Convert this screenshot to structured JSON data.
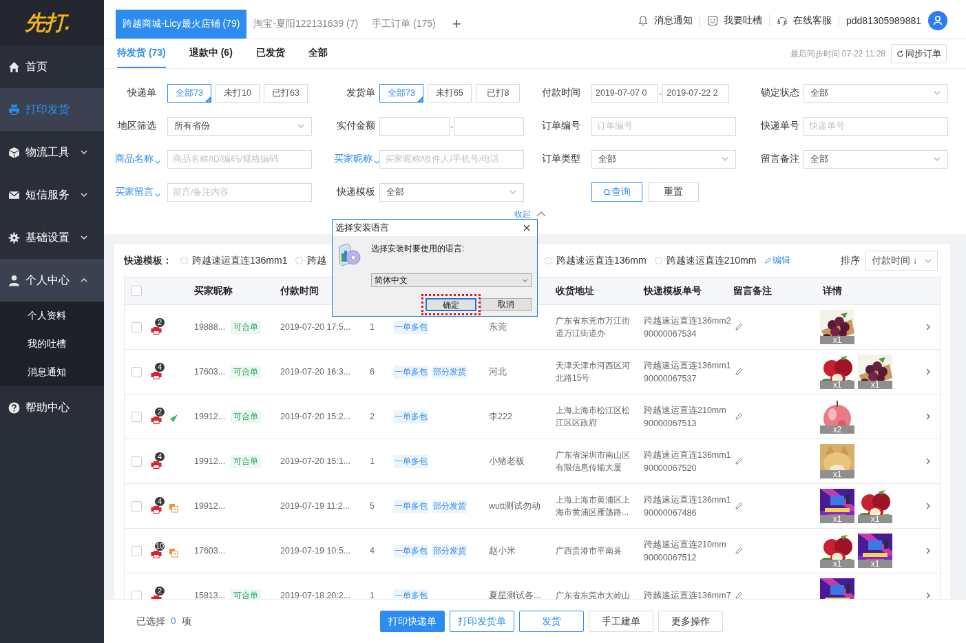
{
  "sidebar": {
    "logo": "先打.",
    "items": [
      {
        "label": "首页",
        "selected": false
      },
      {
        "label": "打印发货",
        "selected": true
      },
      {
        "label": "物流工具",
        "selected": false,
        "expanded": false
      },
      {
        "label": "短信服务",
        "selected": false,
        "expanded": false
      },
      {
        "label": "基础设置",
        "selected": false,
        "expanded": false
      },
      {
        "label": "个人中心",
        "selected": false,
        "expanded": true,
        "children": [
          {
            "label": "个人资料",
            "selected": false
          },
          {
            "label": "我的吐槽",
            "selected": false
          },
          {
            "label": "消息通知",
            "selected": false
          }
        ]
      },
      {
        "label": "帮助中心",
        "selected": false
      }
    ]
  },
  "shop_tabs": [
    {
      "label": "跨越商城-Licy最火店铺 (79)",
      "selected": true
    },
    {
      "label": "淘宝-夏阳122131639 (7)",
      "selected": false
    },
    {
      "label": "手工订单 (175)",
      "selected": false
    }
  ],
  "add_tab": "+",
  "header_links": [
    {
      "label": "消息通知"
    },
    {
      "label": "我要吐槽"
    },
    {
      "label": "在线客服"
    }
  ],
  "user": "pdd81305989881",
  "status_tabs": [
    {
      "label": "待发货 (73)",
      "selected": true
    },
    {
      "label": "退款中 (6)",
      "selected": false
    },
    {
      "label": "已发货",
      "selected": false
    },
    {
      "label": "全部",
      "selected": false
    }
  ],
  "sync": {
    "last_sync": "最后同步时间 07-22 11:28",
    "button": "同步订单"
  },
  "filters": {
    "fields": [
      {
        "kind": "segments",
        "label": "快递单",
        "label_dropdown": false,
        "options": [
          {
            "label": "全部73",
            "selected": true
          },
          {
            "label": "未打10",
            "selected": false
          },
          {
            "label": "已打63",
            "selected": false
          }
        ]
      },
      {
        "kind": "segments",
        "label": "发货单",
        "label_dropdown": false,
        "options": [
          {
            "label": "全部73",
            "selected": true
          },
          {
            "label": "未打65",
            "selected": false
          },
          {
            "label": "已打8",
            "selected": false
          }
        ]
      },
      {
        "kind": "date_range",
        "label": "付款时间",
        "label_dropdown": false,
        "start": "2019-07-07 0",
        "separator": "-",
        "end": "2019-07-22 2"
      },
      {
        "kind": "select",
        "label": "锁定状态",
        "label_dropdown": false,
        "value": "全部"
      },
      {
        "kind": "select",
        "label": "地区筛选",
        "label_dropdown": false,
        "value": "所有省份"
      },
      {
        "kind": "range",
        "label": "实付金额",
        "label_dropdown": false,
        "separator": "-"
      },
      {
        "kind": "input",
        "label": "订单编号",
        "label_dropdown": false,
        "placeholder": "订单编号"
      },
      {
        "kind": "input",
        "label": "快递单号",
        "label_dropdown": false,
        "placeholder": "快递单号"
      },
      {
        "kind": "input",
        "label": "商品名称",
        "label_dropdown": true,
        "placeholder": "商品名称/ID/编码/规格编码"
      },
      {
        "kind": "input",
        "label": "买家昵称",
        "label_dropdown": true,
        "placeholder": "买家昵称/收件人/手机号/电话"
      },
      {
        "kind": "select",
        "label": "订单类型",
        "label_dropdown": false,
        "value": "全部"
      },
      {
        "kind": "select",
        "label": "留言备注",
        "label_dropdown": false,
        "value": "全部"
      },
      {
        "kind": "input",
        "label": "买家留言",
        "label_dropdown": true,
        "placeholder": "留言/备注内容"
      },
      {
        "kind": "select",
        "label": "快递模板",
        "label_dropdown": false,
        "value": "全部"
      },
      {
        "kind": "buttons",
        "search": "查询",
        "reset": "重置"
      }
    ],
    "collapse": "收起"
  },
  "toolbar": {
    "label": "快递模板：",
    "radios": [
      {
        "label": "跨越速运直连136mm1",
        "selected": false
      },
      {
        "label": "跨越",
        "selected": false
      },
      {
        "label": "跨越速运直连136mm",
        "selected": false
      },
      {
        "label": "跨越速运直连210mm",
        "selected": false
      }
    ],
    "edit": "编辑",
    "sort_label": "排序",
    "sort_value": "付款时间 ↓"
  },
  "table": {
    "select_all": {
      "checked": false
    },
    "columns": {
      "buyer": "买家昵称",
      "pay_time": "付款时间",
      "address": "收货地址",
      "template": "快递模板单号",
      "remark": "留言备注",
      "details": "详情"
    },
    "rows": [
      {
        "checked": false,
        "print_count": "2",
        "buyer": "19888...",
        "merge_tag": "可合单",
        "pay_time": "2019-07-20 17:5...",
        "count": "1",
        "tags": [
          "一单多包"
        ],
        "receiver": "东莞",
        "address": "广东省东莞市万江街道万江街道办",
        "template": "跨越速运直连136mm2",
        "tracking_no": "90000067534",
        "products": [
          {
            "qty": "x1"
          }
        ]
      },
      {
        "checked": false,
        "print_count": "4",
        "buyer": "17603...",
        "merge_tag": "可合单",
        "pay_time": "2019-07-20 16:3...",
        "count": "6",
        "tags": [
          "一单多包",
          "部分发货"
        ],
        "receiver": "河北",
        "address": "天津天津市河西区河北路15号",
        "template": "跨越速运直连136mm1",
        "tracking_no": "90000067537",
        "products": [
          {
            "qty": "x1"
          },
          {
            "qty": "x1"
          }
        ]
      },
      {
        "checked": false,
        "print_count": "2",
        "kind": "send",
        "buyer": "19912...",
        "merge_tag": "可合单",
        "pay_time": "2019-07-20 15:2...",
        "count": "2",
        "tags": [
          "一单多包"
        ],
        "receiver": "李222",
        "address": "上海上海市松江区松江区区政府",
        "template": "跨越速运直连210mm",
        "tracking_no": "90000067513",
        "products": [
          {
            "qty": "x2"
          }
        ]
      },
      {
        "checked": false,
        "print_count": "4",
        "buyer": "19912...",
        "merge_tag": "可合单",
        "pay_time": "2019-07-20 15:1...",
        "count": "1",
        "tags": [
          "一单多包"
        ],
        "receiver": "小猪老板",
        "address": "广东省深圳市南山区有限信息传输大厦",
        "template": "跨越速运直连136mm1",
        "tracking_no": "90000067520",
        "products": [
          {
            "qty": "x1"
          }
        ]
      },
      {
        "checked": false,
        "print_count": "4",
        "kind": "merge",
        "buyer": "19912...",
        "pay_time": "2019-07-19 11:2...",
        "count": "5",
        "tags": [
          "一单多包",
          "部分发货"
        ],
        "receiver": "wutt测试勿动",
        "address": "上海上海市黄浦区上海市黄浦区雁荡路...",
        "template": "跨越速运直连136mm1",
        "tracking_no": "90000067486",
        "products": [
          {
            "qty": "x1"
          },
          {
            "qty": "x1"
          }
        ]
      },
      {
        "checked": false,
        "print_count": "10",
        "kind": "merge",
        "buyer": "17603...",
        "pay_time": "2019-07-19 10:5...",
        "count": "4",
        "tags": [
          "一单多包",
          "部分发货"
        ],
        "receiver": "赵小米",
        "address": "广西贵港市平南县",
        "template": "跨越速运直连210mm",
        "tracking_no": "90000067512",
        "products": [
          {
            "qty": "x1"
          },
          {
            "qty": "x1"
          }
        ]
      },
      {
        "checked": false,
        "print_count": "2",
        "buyer": "15813...",
        "merge_tag": "可合单",
        "pay_time": "2019-07-18 20:2...",
        "count": "1",
        "tags": [
          "一单多包"
        ],
        "receiver": "夏星测试各...",
        "address": "广东省东莞市大岭山",
        "template": "跨越速运直连136mm7",
        "products": [
          {
            "kind": "picture"
          }
        ]
      }
    ]
  },
  "footer": {
    "selected_label": "已选择",
    "selected_count": "0",
    "selected_unit": "项",
    "buttons": [
      {
        "label": "打印快递单",
        "kind": "primary"
      },
      {
        "label": "打印发货单",
        "kind": "outline"
      },
      {
        "label": "发货",
        "kind": "outline"
      },
      {
        "label": "手工建单",
        "kind": "default"
      },
      {
        "label": "更多操作",
        "kind": "default"
      }
    ]
  },
  "dialog": {
    "title": "选择安装语言",
    "message": "选择安装时要使用的语言:",
    "language": "简体中文",
    "ok": "确定",
    "cancel": "取消"
  }
}
